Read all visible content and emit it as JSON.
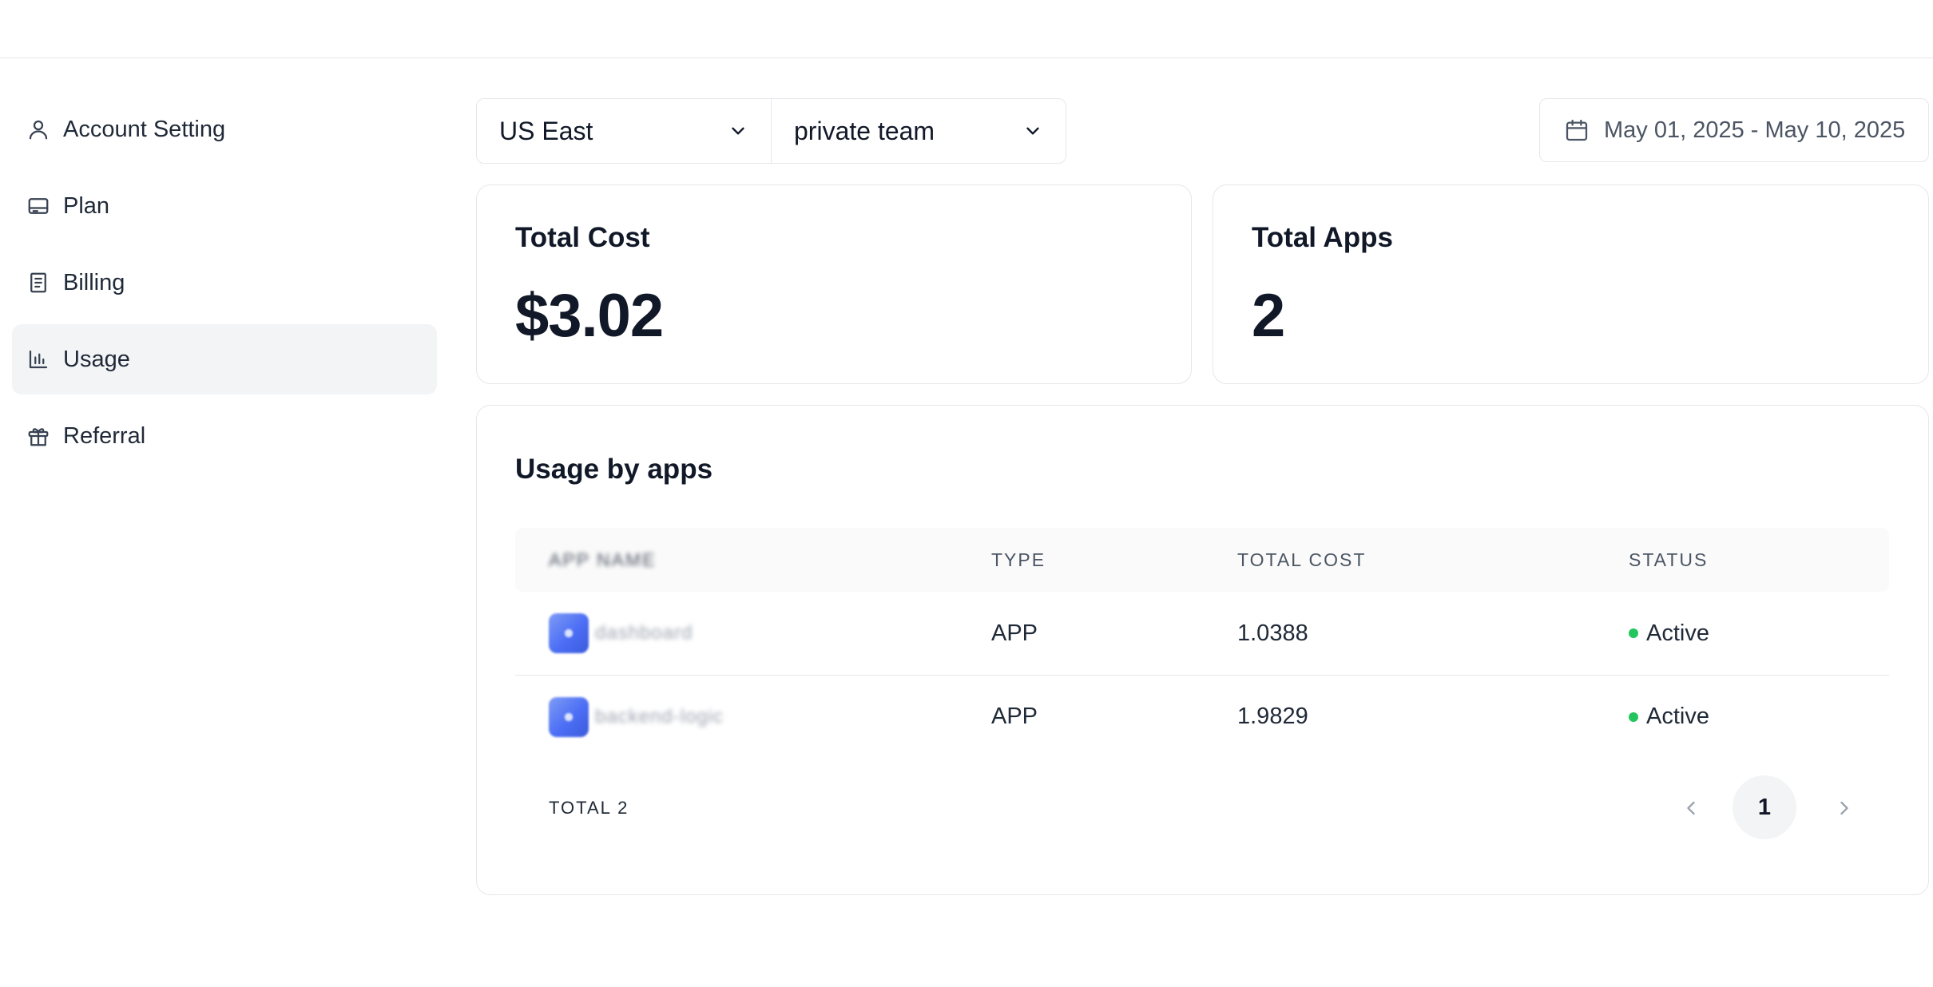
{
  "sidebar": {
    "items": [
      {
        "label": "Account Setting",
        "icon": "user-icon"
      },
      {
        "label": "Plan",
        "icon": "credit-card-icon"
      },
      {
        "label": "Billing",
        "icon": "receipt-icon"
      },
      {
        "label": "Usage",
        "icon": "bar-chart-icon",
        "active": true
      },
      {
        "label": "Referral",
        "icon": "gift-icon"
      }
    ]
  },
  "filters": {
    "region": "US East",
    "team": "private team",
    "date_range": "May 01, 2025 - May 10, 2025"
  },
  "stats": {
    "total_cost": {
      "title": "Total Cost",
      "value": "$3.02"
    },
    "total_apps": {
      "title": "Total Apps",
      "value": "2"
    }
  },
  "usage": {
    "title": "Usage by apps",
    "columns": [
      "APP NAME",
      "TYPE",
      "TOTAL COST",
      "STATUS"
    ],
    "rows": [
      {
        "app_name": "dashboard",
        "type": "APP",
        "total_cost": "1.0388",
        "status": "Active"
      },
      {
        "app_name": "backend-logic",
        "type": "APP",
        "total_cost": "1.9829",
        "status": "Active"
      }
    ],
    "total_label": "TOTAL 2",
    "current_page": "1"
  },
  "colors": {
    "status_active": "#22c55e",
    "active_nav_bg": "#f3f4f6",
    "border": "#e5e7eb"
  }
}
